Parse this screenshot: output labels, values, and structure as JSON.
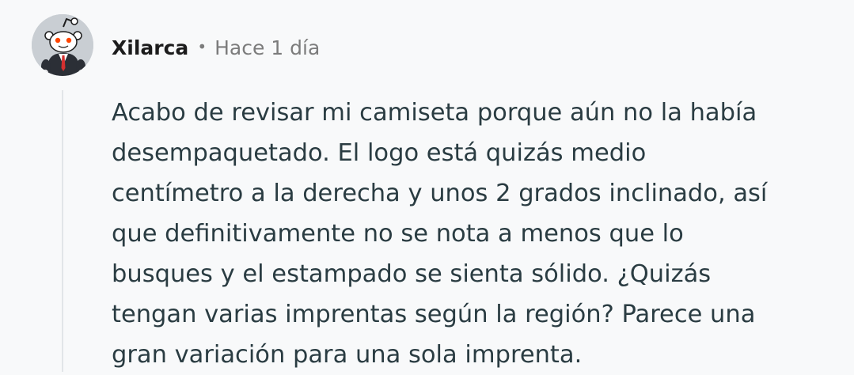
{
  "comment": {
    "author": "Xilarca",
    "separator": "•",
    "timestamp": "Hace 1 día",
    "avatar_icon": "snoo-avatar-icon",
    "body_lines": [
      "Acabo de revisar mi camiseta porque aún no la había",
      "desempaquetado. El logo está quizás medio",
      "centímetro a la derecha y unos 2 grados inclinado, así",
      "que definitivamente no se nota a menos que lo",
      "busques y el estampado se sienta sólido. ¿Quizás",
      "tengan varias imprentas según la región? Parece una",
      "gran variación para una sola imprenta."
    ]
  },
  "colors": {
    "background": "#f8f9fa",
    "thread_line": "#e2e5e8",
    "author": "#1c1c1c",
    "meta": "#7c7c7c",
    "body": "#2a3c42"
  }
}
